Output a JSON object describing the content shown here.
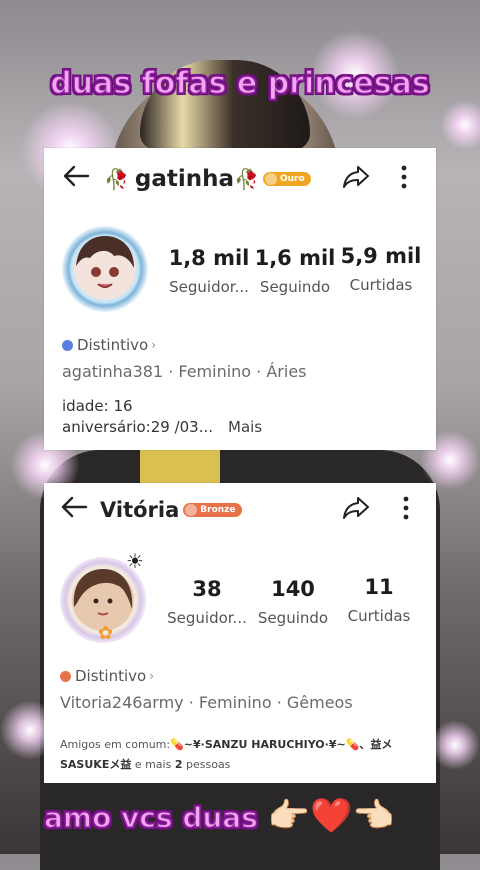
{
  "overlay": {
    "top_caption": "duas fofas e princesas",
    "bottom_caption": "amo vcs duas",
    "bottom_emojis": "👉🏻❤️👈🏻"
  },
  "card1": {
    "back_icon": "back-arrow-icon",
    "rose_left": "🥀",
    "name": "gatinha",
    "rose_right": "🥀",
    "badge": {
      "label": "Ouro",
      "color": "#f0a623"
    },
    "share_icon": "share-icon",
    "more_icon": "more-vertical-icon",
    "stats": [
      {
        "value": "1,8 mil",
        "label": "Seguidor..."
      },
      {
        "value": "1,6 mil",
        "label": "Seguindo"
      },
      {
        "value": "5,9 mil",
        "label": "Curtidas"
      }
    ],
    "distintivo": "Distintivo",
    "profile_line": "agatinha381 · Feminino · Áries",
    "age_line": "idade: 16",
    "birthday_line": "aniversário:29 /03...",
    "more_link": "Mais",
    "accent": "#5b7fe0"
  },
  "card2": {
    "back_icon": "back-arrow-icon",
    "name": "Vitória",
    "badge": {
      "label": "Bronze",
      "color": "#e8734a"
    },
    "share_icon": "share-icon",
    "more_icon": "more-vertical-icon",
    "stats": [
      {
        "value": "38",
        "label": "Seguidor..."
      },
      {
        "value": "140",
        "label": "Seguindo"
      },
      {
        "value": "11",
        "label": "Curtidas"
      }
    ],
    "distintivo": "Distintivo",
    "profile_line": "Vitoria246army · Feminino · Gêmeos",
    "mutual_prefix": "Amigos em comum:",
    "mutual_line1": "💊~¥·SANZU HARUCHIYO·¥~💊、益メ",
    "mutual_line2_name": "SASUKEメ益",
    "mutual_line2_rest_a": " e mais ",
    "mutual_count": "2",
    "mutual_line2_rest_b": " pessoas",
    "accent": "#e8734a"
  }
}
